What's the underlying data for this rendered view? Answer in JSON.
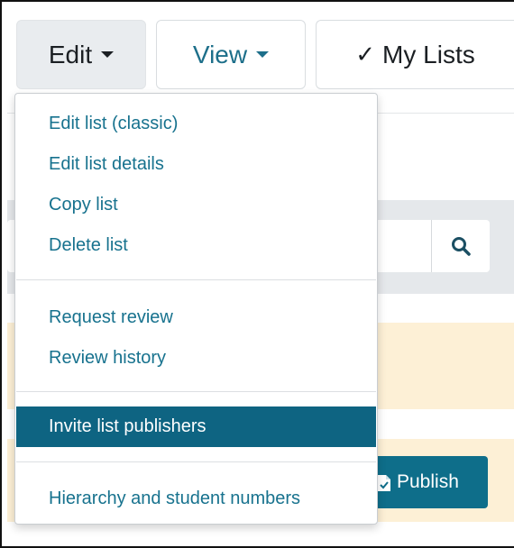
{
  "toolbar": {
    "edit_label": "Edit",
    "view_label": "View",
    "mylists_label": "My Lists"
  },
  "edit_menu": {
    "groups": [
      {
        "items": [
          "Edit list (classic)",
          "Edit list details",
          "Copy list",
          "Delete list"
        ]
      },
      {
        "items": [
          "Request review",
          "Review history"
        ]
      },
      {
        "items": [
          "Invite list publishers"
        ]
      },
      {
        "items": [
          "Hierarchy and student numbers"
        ]
      }
    ],
    "active_item": "Invite list publishers"
  },
  "page": {
    "publish_label": "Publish"
  },
  "colors": {
    "link": "#17728e",
    "active_bg": "#0e6482",
    "primary_button": "#0e6e8a",
    "notice_bg": "#fdf0d6",
    "band_bg": "#e5e8eb"
  },
  "icons": [
    "caret-down-icon",
    "checkmark-icon",
    "search-icon",
    "document-icon"
  ]
}
